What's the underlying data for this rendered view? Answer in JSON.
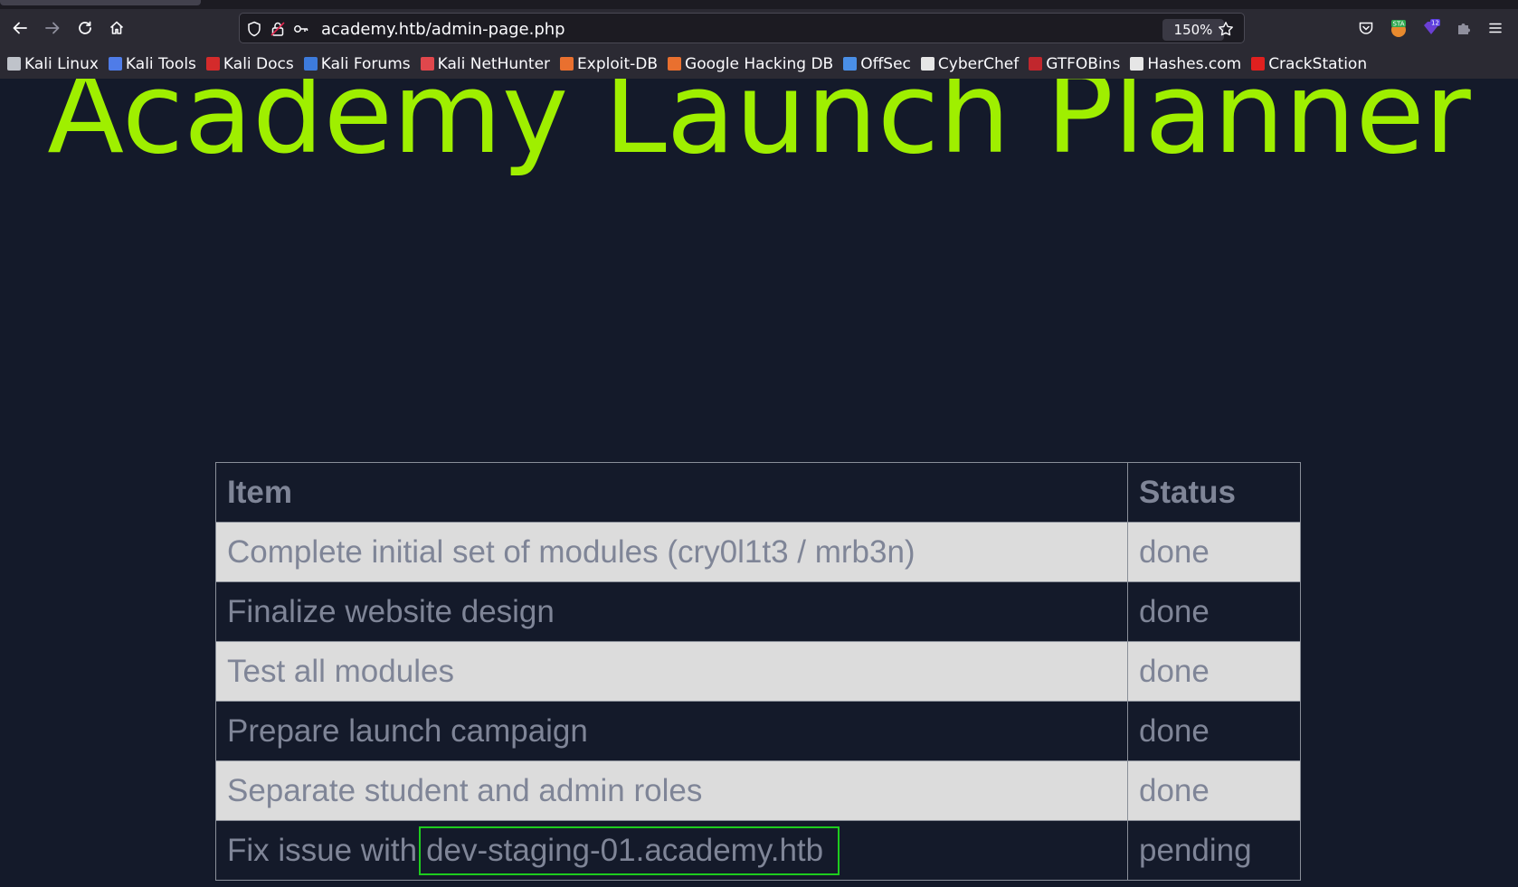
{
  "browser": {
    "url": "academy.htb/admin-page.php",
    "zoom": "150%",
    "toolbar_icons": [
      "back-icon",
      "forward-icon",
      "reload-icon",
      "home-icon",
      "shield-icon",
      "lock-icon",
      "key-icon",
      "star-icon",
      "pocket-icon",
      "extension-icon",
      "extension-icon",
      "extensions-puzzle-icon",
      "menu-icon"
    ],
    "extension_badges": {
      "ext1": "STA",
      "ext2": "12"
    },
    "bookmarks": [
      {
        "label": "Kali Linux",
        "icon": "kali-dragon-icon",
        "color": "#bfc3ca"
      },
      {
        "label": "Kali Tools",
        "icon": "kali-tools-icon",
        "color": "#4f7ce8"
      },
      {
        "label": "Kali Docs",
        "icon": "kali-docs-icon",
        "color": "#d42b2b"
      },
      {
        "label": "Kali Forums",
        "icon": "kali-forums-icon",
        "color": "#3d7bdc"
      },
      {
        "label": "Kali NetHunter",
        "icon": "nethunter-icon",
        "color": "#e0474c"
      },
      {
        "label": "Exploit-DB",
        "icon": "exploit-db-icon",
        "color": "#e9702f"
      },
      {
        "label": "Google Hacking DB",
        "icon": "ghdb-icon",
        "color": "#e9702f"
      },
      {
        "label": "OffSec",
        "icon": "offsec-icon",
        "color": "#4a8fe7"
      },
      {
        "label": "CyberChef",
        "icon": "cyberchef-icon",
        "color": "#e6e6e6"
      },
      {
        "label": "GTFOBins",
        "icon": "gtfobins-icon",
        "color": "#c1272d"
      },
      {
        "label": "Hashes.com",
        "icon": "hashes-icon",
        "color": "#e6e6e6"
      },
      {
        "label": "CrackStation",
        "icon": "crackstation-icon",
        "color": "#e0201f"
      }
    ]
  },
  "page": {
    "title": "Academy Launch Planner",
    "title_color": "#9fef00",
    "background": "#141a2a",
    "table": {
      "headers": {
        "item": "Item",
        "status": "Status"
      },
      "rows": [
        {
          "item": "Complete initial set of modules (cry0l1t3 / mrb3n)",
          "status": "done"
        },
        {
          "item": "Finalize website design",
          "status": "done"
        },
        {
          "item": "Test all modules",
          "status": "done"
        },
        {
          "item": "Prepare launch campaign",
          "status": "done"
        },
        {
          "item": "Separate student and admin roles",
          "status": "done"
        },
        {
          "item": "Fix issue with",
          "highlight": "dev-staging-01.academy.htb",
          "status": "pending"
        }
      ],
      "highlight_color": "#1ecc1e"
    }
  }
}
